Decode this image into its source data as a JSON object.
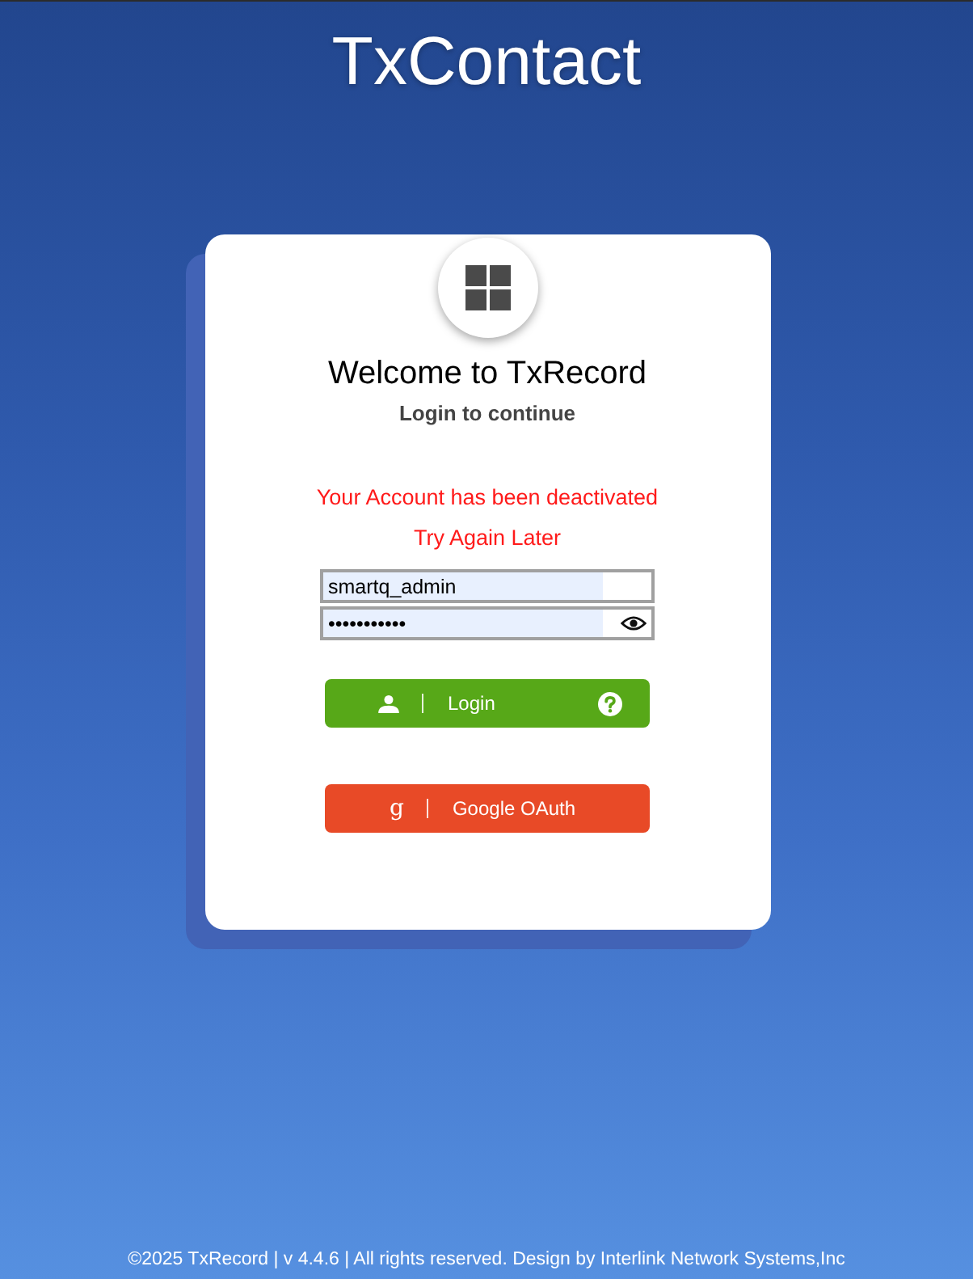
{
  "header": {
    "title": "TxContact"
  },
  "card": {
    "heading": "Welcome to TxRecord",
    "subheading": "Login to continue",
    "alerts": [
      "Your Account has been deactivated",
      "Try Again Later"
    ],
    "fields": [
      {
        "kind": "text",
        "value": "smartq_admin",
        "autofilled": true
      },
      {
        "kind": "password",
        "value": "•••••••••••",
        "autofilled": true
      }
    ],
    "buttons": [
      {
        "kind": "login",
        "label": "Login"
      },
      {
        "kind": "google",
        "label": "Google OAuth",
        "glyph": "g"
      }
    ]
  },
  "footer": {
    "text": "©2025 TxRecord | v 4.4.6 | All rights reserved. Design by Interlink Network Systems,Inc"
  }
}
